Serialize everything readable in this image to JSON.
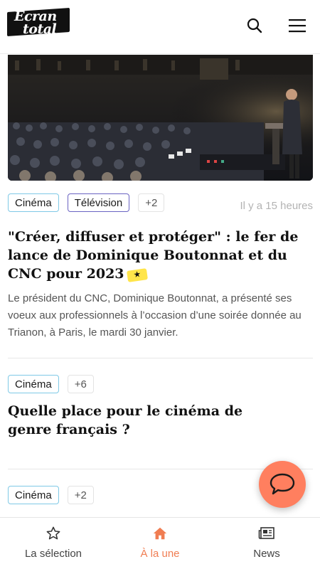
{
  "header": {
    "logo_line1": "Écran",
    "logo_line2": "total"
  },
  "articles": [
    {
      "tags": [
        "Cinéma",
        "Télévision"
      ],
      "more": "+2",
      "time": "Il y a 15 heures",
      "title": "\"Créer, diffuser et protéger\" : le fer de lance de Dominique Boutonnat et du CNC pour 2023",
      "excerpt": "Le président du CNC, Dominique Boutonnat, a présenté ses voeux aux professionnels à l’occasion d’une soirée donnée au Trianon, à Paris, le mardi 30 janvier."
    },
    {
      "tags": [
        "Cinéma"
      ],
      "more": "+6",
      "title": "Quelle place pour le cinéma de genre français ?"
    },
    {
      "tags": [
        "Cinéma"
      ],
      "more": "+2"
    }
  ],
  "bottom_nav": [
    {
      "label": "La sélection",
      "icon": "star-icon"
    },
    {
      "label": "À la une",
      "icon": "home-icon",
      "active": true
    },
    {
      "label": "News",
      "icon": "newspaper-icon"
    }
  ],
  "colors": {
    "accent": "#f07d52",
    "fab": "#ff7f5f",
    "tag_cinema_border": "#7fc9e6",
    "tag_tv_border": "#6a63c2",
    "badge_yellow": "#ffe54a"
  }
}
